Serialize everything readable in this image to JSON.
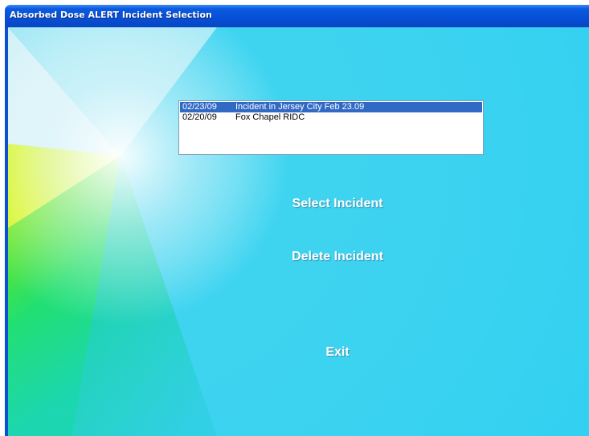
{
  "window": {
    "title": "Absorbed Dose ALERT Incident Selection"
  },
  "incidents": [
    {
      "date": "02/23/09",
      "name": "Incident in Jersey City Feb 23.09",
      "selected": true
    },
    {
      "date": "02/20/09",
      "name": "Fox Chapel RIDC",
      "selected": false
    }
  ],
  "buttons": {
    "select_label": "Select Incident",
    "delete_label": "Delete Incident",
    "exit_label": "Exit"
  },
  "colors": {
    "titlebar": "#0650d8",
    "background": "#39d0f2",
    "selection": "#316ac5",
    "button_text": "#ffffff"
  }
}
